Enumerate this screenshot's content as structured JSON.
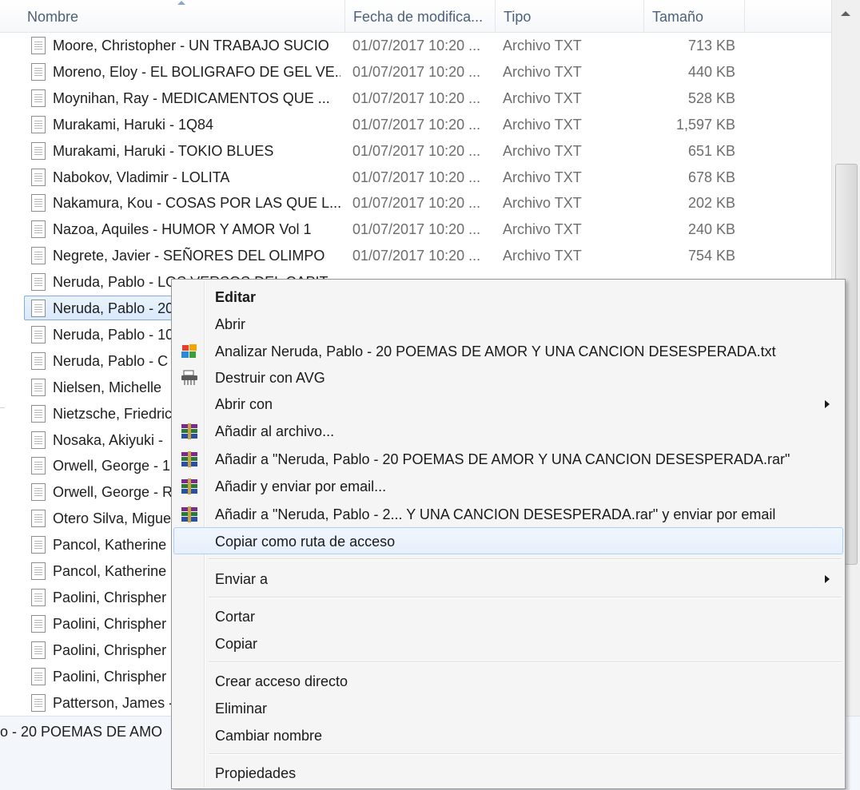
{
  "columns": {
    "name": "Nombre",
    "date": "Fecha de modifica...",
    "type": "Tipo",
    "size": "Tamaño"
  },
  "files": [
    {
      "name": "Moore, Christopher - UN TRABAJO SUCIO",
      "date": "01/07/2017 10:20 ...",
      "type": "Archivo TXT",
      "size": "713 KB"
    },
    {
      "name": "Moreno, Eloy - EL BOLIGRAFO DE GEL VE...",
      "date": "01/07/2017 10:20 ...",
      "type": "Archivo TXT",
      "size": "440 KB"
    },
    {
      "name": "Moynihan, Ray - MEDICAMENTOS QUE ...",
      "date": "01/07/2017 10:20 ...",
      "type": "Archivo TXT",
      "size": "528 KB"
    },
    {
      "name": "Murakami, Haruki - 1Q84",
      "date": "01/07/2017 10:20 ...",
      "type": "Archivo TXT",
      "size": "1,597 KB"
    },
    {
      "name": "Murakami, Haruki - TOKIO BLUES",
      "date": "01/07/2017 10:20 ...",
      "type": "Archivo TXT",
      "size": "651 KB"
    },
    {
      "name": "Nabokov, Vladimir - LOLITA",
      "date": "01/07/2017 10:20 ...",
      "type": "Archivo TXT",
      "size": "678 KB"
    },
    {
      "name": "Nakamura, Kou - COSAS POR LAS QUE L...",
      "date": "01/07/2017 10:20 ...",
      "type": "Archivo TXT",
      "size": "202 KB"
    },
    {
      "name": "Nazoa, Aquiles - HUMOR Y AMOR Vol 1",
      "date": "01/07/2017 10:20 ...",
      "type": "Archivo TXT",
      "size": "240 KB"
    },
    {
      "name": "Negrete, Javier - SEÑORES DEL OLIMPO",
      "date": "01/07/2017 10:20 ...",
      "type": "Archivo TXT",
      "size": "754 KB"
    },
    {
      "name": "Neruda, Pablo  - LOS VERSOS DEL CAPIT...",
      "date": "",
      "type": "",
      "size": ""
    },
    {
      "name": "Neruda, Pablo - 20",
      "date": "",
      "type": "",
      "size": ""
    },
    {
      "name": "Neruda, Pablo - 10",
      "date": "",
      "type": "",
      "size": ""
    },
    {
      "name": "Neruda, Pablo - C",
      "date": "",
      "type": "",
      "size": ""
    },
    {
      "name": "Nielsen, Michelle",
      "date": "",
      "type": "",
      "size": ""
    },
    {
      "name": "Nietzsche, Friedric",
      "date": "",
      "type": "",
      "size": ""
    },
    {
      "name": "Nosaka, Akiyuki -",
      "date": "",
      "type": "",
      "size": ""
    },
    {
      "name": "Orwell, George - 1",
      "date": "",
      "type": "",
      "size": ""
    },
    {
      "name": "Orwell, George - R",
      "date": "",
      "type": "",
      "size": ""
    },
    {
      "name": "Otero Silva, Migue",
      "date": "",
      "type": "",
      "size": ""
    },
    {
      "name": "Pancol, Katherine",
      "date": "",
      "type": "",
      "size": ""
    },
    {
      "name": "Pancol, Katherine",
      "date": "",
      "type": "",
      "size": ""
    },
    {
      "name": "Paolini, Chrispher",
      "date": "",
      "type": "",
      "size": ""
    },
    {
      "name": "Paolini, Chrispher",
      "date": "",
      "type": "",
      "size": ""
    },
    {
      "name": "Paolini, Chrispher",
      "date": "",
      "type": "",
      "size": ""
    },
    {
      "name": "Paolini, Chrispher",
      "date": "",
      "type": "",
      "size": ""
    },
    {
      "name": "Patterson, James -",
      "date": "",
      "type": "",
      "size": ""
    }
  ],
  "status_text": "o - 20 POEMAS DE AMO",
  "context_menu": {
    "editar": "Editar",
    "abrir": "Abrir",
    "analizar": "Analizar Neruda, Pablo - 20 POEMAS DE AMOR Y UNA CANCION DESESPERADA.txt",
    "destruir": "Destruir con AVG",
    "abrir_con": "Abrir con",
    "anadir_archivo": "Añadir al archivo...",
    "anadir_rar": "Añadir a \"Neruda, Pablo - 20 POEMAS DE AMOR Y UNA CANCION DESESPERADA.rar\"",
    "anadir_email": "Añadir y enviar por email...",
    "anadir_rar_email": "Añadir a \"Neruda, Pablo - 2... Y UNA CANCION DESESPERADA.rar\" y enviar por email",
    "copiar_ruta": "Copiar como ruta de acceso",
    "enviar_a": "Enviar a",
    "cortar": "Cortar",
    "copiar": "Copiar",
    "crear_acceso": "Crear acceso directo",
    "eliminar": "Eliminar",
    "cambiar_nombre": "Cambiar nombre",
    "propiedades": "Propiedades"
  },
  "icons": {
    "file": "text-file-icon",
    "avg_analyze": "avg-logo-icon",
    "avg_shred": "shredder-icon",
    "winrar": "winrar-books-icon"
  }
}
